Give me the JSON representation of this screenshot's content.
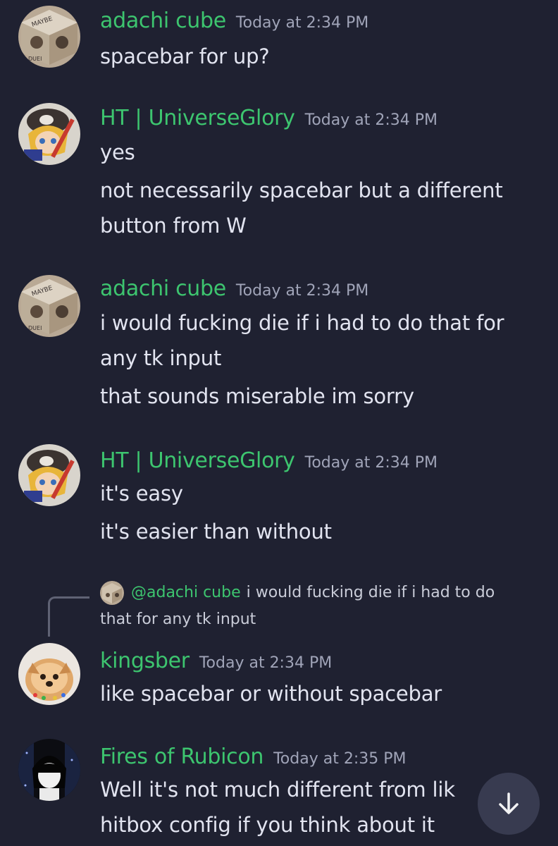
{
  "messages": [
    {
      "author": "adachi cube",
      "timestamp": "Today at 2:34 PM",
      "avatar": "cube-avatar",
      "lines": [
        "spacebar for up?"
      ]
    },
    {
      "author": "HT | UniverseGlory",
      "timestamp": "Today at 2:34 PM",
      "avatar": "anime-character-avatar",
      "lines": [
        "yes",
        "not necessarily spacebar but a different",
        "button from W"
      ]
    },
    {
      "author": "adachi cube",
      "timestamp": "Today at 2:34 PM",
      "avatar": "cube-avatar",
      "lines": [
        "i would fucking die if i had to do that for",
        "any tk input",
        "that sounds miserable im sorry"
      ]
    },
    {
      "author": "HT | UniverseGlory",
      "timestamp": "Today at 2:34 PM",
      "avatar": "anime-character-avatar",
      "lines": [
        "it's easy",
        "it's easier than without"
      ]
    },
    {
      "author": "kingsber",
      "timestamp": "Today at 2:34 PM",
      "avatar": "dog-avatar",
      "reply": {
        "mention": "@adachi cube",
        "text_line1": "i would fucking die if i had to do",
        "text_line2": "that for any tk input"
      },
      "lines": [
        "like spacebar or without spacebar"
      ]
    },
    {
      "author": "Fires of Rubicon",
      "timestamp": "Today at 2:35 PM",
      "avatar": "monochrome-girl-avatar",
      "lines": [
        "Well it's not much different from lik",
        "hitbox config if you think about it"
      ]
    }
  ],
  "jump_to_present_icon": "arrow-down-icon",
  "colors": {
    "background": "#1f2131",
    "username": "#3dc56f",
    "timestamp": "#a0a4b8",
    "message_text": "#e2e4f0",
    "jump_button": "#3a3d52"
  }
}
